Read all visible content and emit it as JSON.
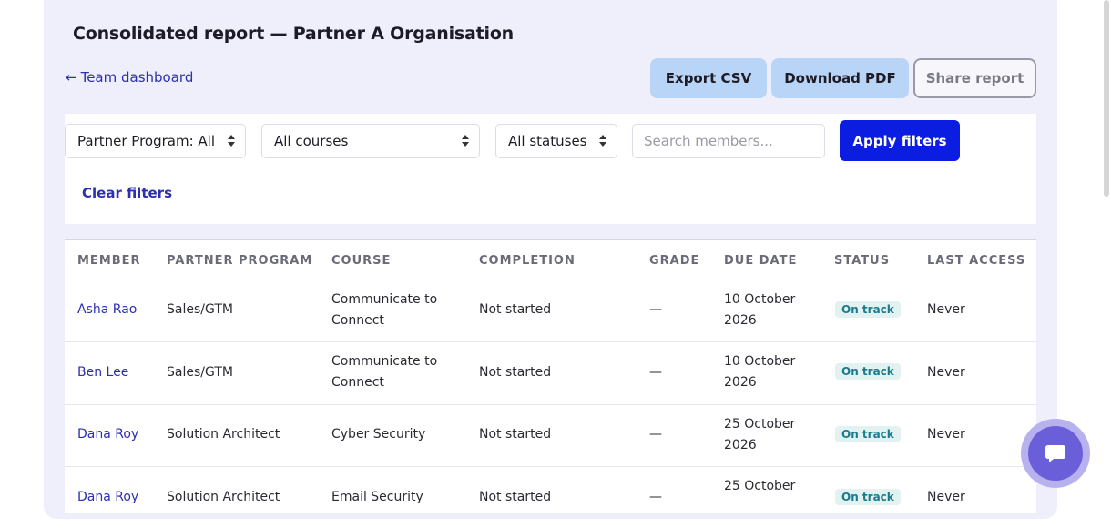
{
  "header": {
    "title": "Consolidated report — Partner A Organisation",
    "back_arrow": "←",
    "back_label": "Team dashboard"
  },
  "actions": {
    "export_csv": "Export CSV",
    "download_pdf": "Download PDF",
    "share_report": "Share report"
  },
  "filters": {
    "program_value": "Partner Program: All",
    "course_value": "All courses",
    "status_value": "All statuses",
    "search_placeholder": "Search members...",
    "apply_label": "Apply filters",
    "clear_label": "Clear filters"
  },
  "table": {
    "columns": [
      "MEMBER",
      "PARTNER PROGRAM",
      "COURSE",
      "COMPLETION",
      "GRADE",
      "DUE DATE",
      "STATUS",
      "LAST ACCESS"
    ],
    "rows": [
      {
        "member": "Asha Rao",
        "program": "Sales/GTM",
        "course_l1": "Communicate to",
        "course_l2": "Connect",
        "completion": "Not started",
        "grade": "—",
        "due_l1": "10 October",
        "due_l2": "2026",
        "status": "On track",
        "last_access": "Never"
      },
      {
        "member": "Ben Lee",
        "program": "Sales/GTM",
        "course_l1": "Communicate to",
        "course_l2": "Connect",
        "completion": "Not started",
        "grade": "—",
        "due_l1": "10 October",
        "due_l2": "2026",
        "status": "On track",
        "last_access": "Never"
      },
      {
        "member": "Dana Roy",
        "program": "Solution Architect",
        "course_l1": "Cyber Security",
        "course_l2": "",
        "completion": "Not started",
        "grade": "—",
        "due_l1": "25 October",
        "due_l2": "2026",
        "status": "On track",
        "last_access": "Never"
      },
      {
        "member": "Dana Roy",
        "program": "Solution Architect",
        "course_l1": "Email Security",
        "course_l2": "",
        "completion": "Not started",
        "grade": "—",
        "due_l1": "25 October",
        "due_l2": "",
        "status": "On track",
        "last_access": "Never"
      }
    ]
  },
  "icons": {
    "chat": "chat-bubble-icon"
  },
  "colors": {
    "accent": "#0a1de0",
    "link": "#2b2fb0",
    "panel_bg": "#efeefb",
    "secondary_button": "#b8d4f7",
    "status_badge_bg": "#e2f2f1",
    "status_badge_text": "#1c7a8e",
    "chat_button": "#6a5fd8"
  }
}
